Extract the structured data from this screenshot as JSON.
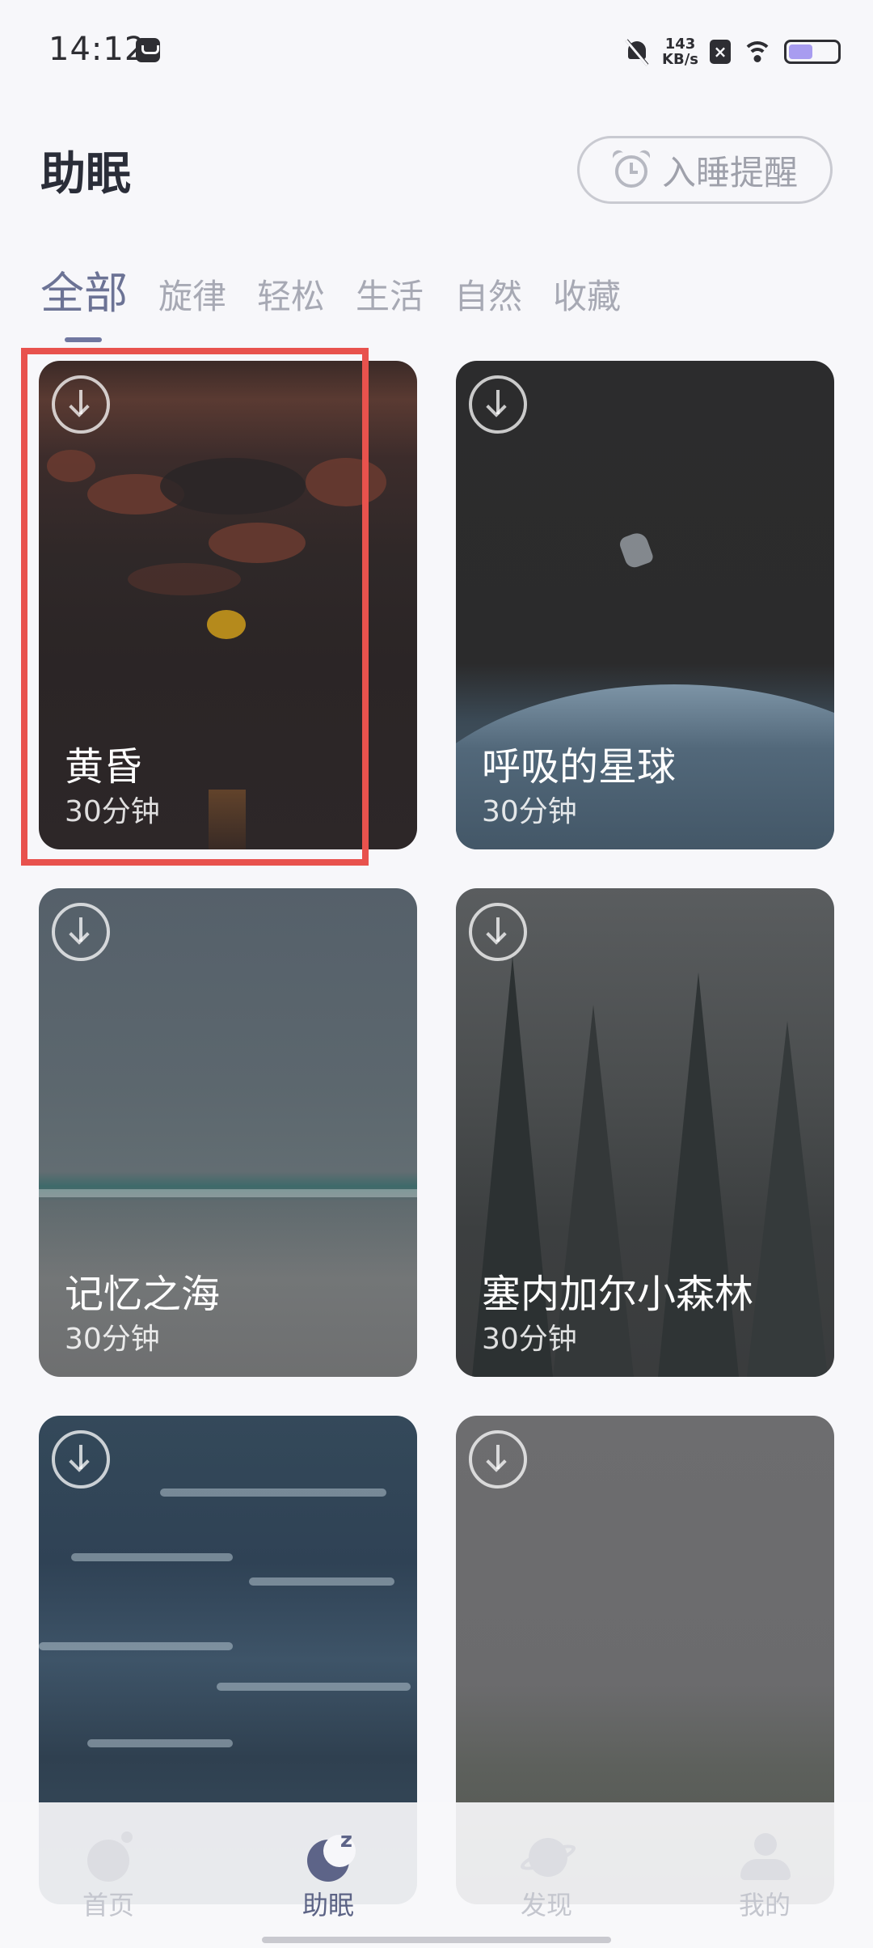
{
  "status_bar": {
    "time": "14:12",
    "net_speed_value": "143",
    "net_speed_unit": "KB/s",
    "sim_label": "×",
    "battery_level": 0.5
  },
  "header": {
    "title": "助眠",
    "reminder_label": "入睡提醒"
  },
  "tabs": [
    "全部",
    "旋律",
    "轻松",
    "生活",
    "自然",
    "收藏"
  ],
  "active_tab": "全部",
  "cards": [
    {
      "title": "黄昏",
      "duration": "30分钟"
    },
    {
      "title": "呼吸的星球",
      "duration": "30分钟"
    },
    {
      "title": "记忆之海",
      "duration": "30分钟"
    },
    {
      "title": "塞内加尔小森林",
      "duration": "30分钟"
    },
    {
      "title": "",
      "duration": ""
    },
    {
      "title": "",
      "duration": ""
    }
  ],
  "bottom_nav": [
    {
      "label": "首页",
      "icon": "moon-star-icon"
    },
    {
      "label": "助眠",
      "icon": "sleep-moon-icon",
      "active": true
    },
    {
      "label": "发现",
      "icon": "planet-icon"
    },
    {
      "label": "我的",
      "icon": "user-icon"
    }
  ],
  "colors": {
    "accent": "#5c6385",
    "highlight": "#e8524d"
  }
}
